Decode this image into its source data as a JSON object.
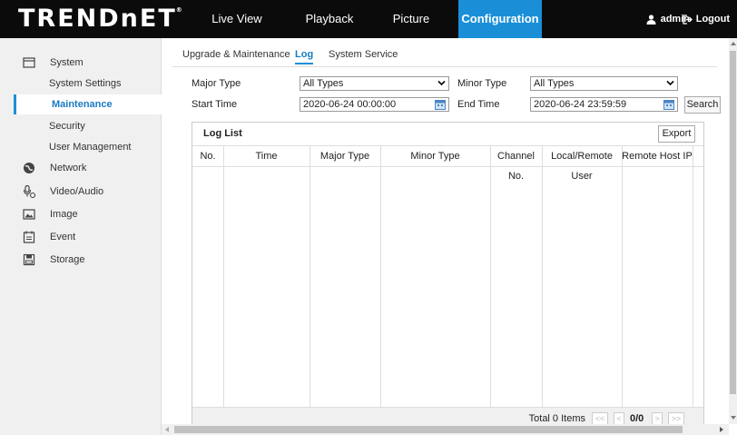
{
  "brand": {
    "logo": "TRENDnET",
    "reg": "®"
  },
  "nav": {
    "live_view": "Live View",
    "playback": "Playback",
    "picture": "Picture",
    "configuration": "Configuration",
    "user": "admin",
    "logout": "Logout"
  },
  "sidebar": {
    "system": "System",
    "system_settings": "System Settings",
    "maintenance": "Maintenance",
    "security": "Security",
    "user_management": "User Management",
    "network": "Network",
    "video_audio": "Video/Audio",
    "image": "Image",
    "event": "Event",
    "storage": "Storage"
  },
  "tabs": {
    "upgrade": "Upgrade & Maintenance",
    "log": "Log",
    "system_service": "System Service"
  },
  "filters": {
    "major_type_label": "Major Type",
    "major_type_value": "All Types",
    "minor_type_label": "Minor Type",
    "minor_type_value": "All Types",
    "start_time_label": "Start Time",
    "start_time_value": "2020-06-24 00:00:00",
    "end_time_label": "End Time",
    "end_time_value": "2020-06-24 23:59:59",
    "search_label": "Search"
  },
  "log": {
    "title": "Log List",
    "export_label": "Export",
    "columns": [
      "No.",
      "Time",
      "Major Type",
      "Minor Type",
      "Channel No.",
      "Local/Remote User",
      "Remote Host IP"
    ],
    "total": "Total 0 Items",
    "page_info": "0/0",
    "first": "<<",
    "prev": "<",
    "next": ">",
    "last": ">>"
  },
  "colors": {
    "accent": "#1a8fd8",
    "topbar": "#0b0b0b",
    "sidebar_bg": "#f0f0f0"
  }
}
